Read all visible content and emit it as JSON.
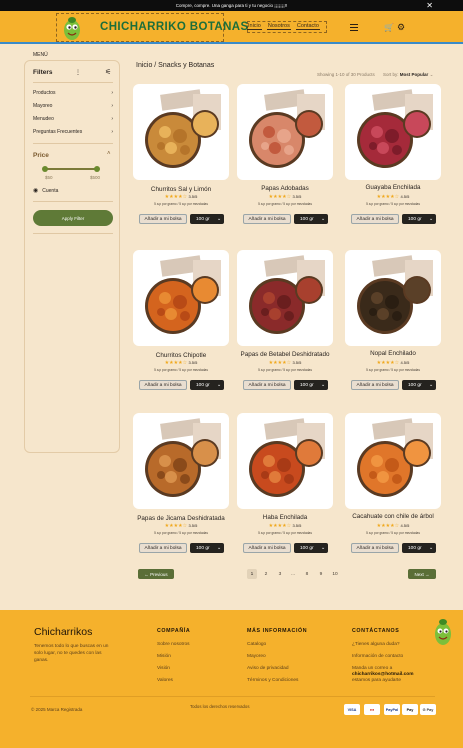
{
  "announcement": {
    "text": "Compre, compre. Una ganga para ti y tu negocio ¡¡¡¡¡¡¡!!",
    "close": "✕"
  },
  "header": {
    "brand": "CHICHARRIKO BOTANAS",
    "nav": [
      "Inicio",
      "Nosotros",
      "Contacto"
    ],
    "icons": [
      "menu-icon",
      "cart-icon",
      "gear-icon"
    ]
  },
  "menu_label": "MENÚ",
  "sidebar": {
    "title": "Filters",
    "items": [
      {
        "label": "Productos"
      },
      {
        "label": "Mayoreo"
      },
      {
        "label": "Menudeo"
      },
      {
        "label": "Preguntas Frecuentes"
      }
    ],
    "price_title": "Price",
    "price_min": "$50",
    "price_max": "$500",
    "account": "Cuenta",
    "apply": "Apply Filter"
  },
  "breadcrumb": "Inicio / Snacks y Botanas",
  "results": {
    "showing": "Showing 1-10 of 30 Products",
    "sort_label": "Sort by:",
    "sort_value": "Most Popular"
  },
  "products": [
    {
      "name": "Churritos Sal y Limón",
      "stars": "★★★★☆",
      "score": "3.5/5",
      "desc": "5 a.p por gramo / 5 a.p por mezcladas",
      "add": "Añadir a mi bolsa",
      "size": "100 gr"
    },
    {
      "name": "Papas Adobadas",
      "stars": "★★★★☆",
      "score": "3.5/5",
      "desc": "5 a.p por gramo / 5 a.p por mezcladas",
      "add": "Añadir a mi bolsa",
      "size": "100 gr"
    },
    {
      "name": "Guayaba Enchilada",
      "stars": "★★★★☆",
      "score": "4.5/5",
      "desc": "5 a.p por gramo / 5 a.p por mezcladas",
      "add": "Añadir a mi bolsa",
      "size": "100 gr"
    },
    {
      "name": "Churritos Chipotle",
      "stars": "★★★★☆",
      "score": "3.5/5",
      "desc": "5 a.p por gramo / 5 a.p por mezcladas",
      "add": "Añadir a mi bolsa",
      "size": "100 gr"
    },
    {
      "name": "Papas de Betabel Deshidratado",
      "stars": "★★★★☆",
      "score": "3.5/5",
      "desc": "5 a.p por gramo / 5 a.p por mezcladas",
      "add": "Añadir a mi bolsa",
      "size": "100 gr"
    },
    {
      "name": "Nopal Enchilado",
      "stars": "★★★★☆",
      "score": "4.5/5",
      "desc": "5 a.p por gramo / 5 a.p por mezcladas",
      "add": "Añadir a mi bolsa",
      "size": "100 gr"
    },
    {
      "name": "Papas de Jicama Deshidratada",
      "stars": "★★★★☆",
      "score": "3.5/5",
      "desc": "5 a.p por gramo / 5 a.p por mezcladas",
      "add": "Añadir a mi bolsa",
      "size": "100 gr"
    },
    {
      "name": "Haba Enchilada",
      "stars": "★★★★☆",
      "score": "3.5/5",
      "desc": "5 a.p por gramo / 5 a.p por mezcladas",
      "add": "Añadir a mi bolsa",
      "size": "100 gr"
    },
    {
      "name": "Cacahuate con chile de árbol",
      "stars": "★★★★☆",
      "score": "4.5/5",
      "desc": "5 a.p por gramo / 5 a.p por mezcladas",
      "add": "Añadir a mi bolsa",
      "size": "100 gr"
    }
  ],
  "pagination": {
    "prev": "← Previous",
    "next": "Next →",
    "pages": [
      "1",
      "2",
      "3",
      "...",
      "8",
      "9",
      "10"
    ],
    "current": "1"
  },
  "footer": {
    "brand": "Chicharrikos",
    "tagline": "Tenemos todo lo que buscas en un solo lugar, no te quedes con las ganas.",
    "columns": [
      {
        "title": "COMPAÑÍA",
        "links": [
          "Sobre nosotros",
          "Misión",
          "Visión",
          "Valores"
        ]
      },
      {
        "title": "MÁS INFORMACIÓN",
        "links": [
          "Catalogo",
          "Mayoreo",
          "Aviso de privacidad",
          "Términos y Condiciones"
        ]
      },
      {
        "title": "CONTÁCTANOS",
        "links": [
          "¿Tienes alguna duda?",
          "Información de contacto",
          "Manda un correo a",
          "chicharrikos@hotmail.com",
          "estamos para ayudarte"
        ]
      }
    ],
    "copyright": "© 2025 Marca Registrada",
    "rights": "Todos los derechos reservados",
    "payments": [
      "VISA",
      "MC",
      "PayPal",
      "Pay",
      "G Pay"
    ]
  },
  "colors": {
    "accent_yellow": "#f5b12c",
    "brand_green": "#1c6e3a",
    "button_green": "#5f7a37",
    "background": "#f6e6cc"
  }
}
